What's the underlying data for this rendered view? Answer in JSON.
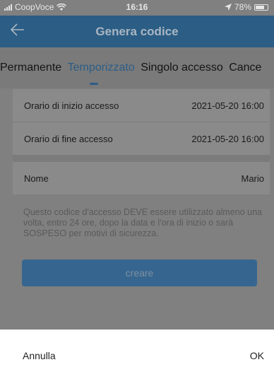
{
  "status_bar": {
    "carrier": "CoopVoce",
    "time": "16:16",
    "battery": "78%",
    "battery_level": 0.78,
    "icons": [
      "signal-icon",
      "wifi-icon",
      "location-icon",
      "battery-icon"
    ]
  },
  "nav": {
    "title": "Genera codice",
    "back_icon": "back-arrow-icon"
  },
  "tabs": [
    {
      "label": "Permanente",
      "active": false
    },
    {
      "label": "Temporizzato",
      "active": true
    },
    {
      "label": "Singolo accesso",
      "active": false
    },
    {
      "label": "Cance",
      "active": false
    }
  ],
  "form": {
    "start": {
      "label": "Orario di inizio accesso",
      "value": "2021-05-20 16:00"
    },
    "end": {
      "label": "Orario di fine accesso",
      "value": "2021-05-20 16:00"
    },
    "name": {
      "label": "Nome",
      "value": "Mario"
    }
  },
  "notice": "Questo codice d'accesso DEVE essere utilizzato almeno una volta, entro 24 ore, dopo la data e l'ora di inizio o sarà SOSPESO per motivi di sicurezza.",
  "create_button": "creare",
  "dialog": {
    "cancel": "Annulla",
    "ok": "OK"
  },
  "colors": {
    "accent": "#2c5d86",
    "overlay": "#808080"
  }
}
